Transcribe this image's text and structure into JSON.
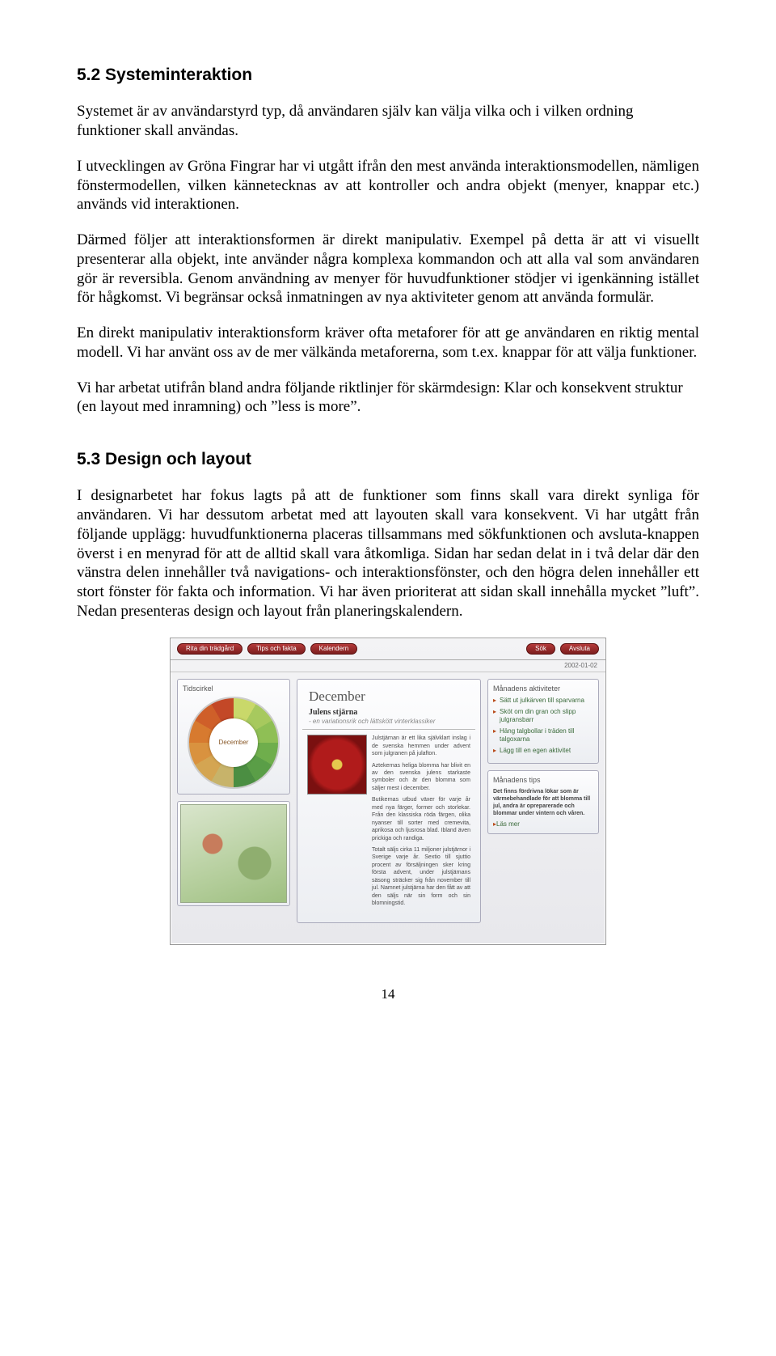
{
  "h1": "5.2 Systeminteraktion",
  "p1": "Systemet är av användarstyrd typ, då användaren själv kan välja vilka och i vilken ordning funktioner skall användas.",
  "p2": "I utvecklingen av Gröna Fingrar har vi utgått ifrån den mest använda interaktionsmodellen, nämligen fönstermodellen, vilken kännetecknas av att kontroller och andra objekt (menyer, knappar etc.) används vid interaktionen.",
  "p3": "Därmed följer att interaktionsformen är direkt manipulativ. Exempel på detta är att vi visuellt presenterar alla objekt, inte använder några komplexa kommandon och att alla val som användaren gör är reversibla. Genom användning av menyer för huvudfunktioner stödjer vi igenkänning istället för hågkomst. Vi begränsar också inmatningen av nya aktiviteter genom att använda formulär.",
  "p4": "En direkt manipulativ interaktionsform kräver ofta metaforer för att ge användaren en riktig mental modell. Vi har använt oss av de mer välkända metaforerna, som t.ex. knappar för att välja funktioner.",
  "p5": "Vi har arbetat utifrån bland andra följande riktlinjer för skärmdesign: Klar och konsekvent struktur (en layout med inramning) och ”less is more”.",
  "h2": "5.3 Design och layout",
  "p6": "I designarbetet har fokus lagts på att de funktioner som finns skall vara direkt synliga för användaren. Vi har dessutom arbetat med att layouten skall vara konsekvent. Vi har utgått från följande upplägg: huvudfunktionerna placeras tillsammans med sökfunktionen och avsluta-knappen överst i en menyrad för att de alltid skall vara åtkomliga. Sidan har sedan delat in i två delar där den vänstra delen innehåller två navigations- och interaktionsfönster, och den högra delen innehåller ett stort fönster för fakta och information. Vi har även prioriterat att sidan skall innehålla mycket ”luft”. Nedan presenteras design och layout från planeringskalendern.",
  "shot": {
    "menu": {
      "a": "Rita din trädgård",
      "b": "Tips och fakta",
      "c": "Kalendern",
      "d": "Sök",
      "e": "Avsluta"
    },
    "date": "2002-01-02",
    "left": {
      "panel1_title": "Tidscirkel",
      "wheel_label": "December"
    },
    "center": {
      "title": "December",
      "subtitle": "Julens stjärna",
      "subtitle2": "- en variationsrik och lättskött vinterklassiker",
      "para1": "Julstjärnan är ett lika självklart inslag i de svenska hemmen under advent som julgranen på julafton.",
      "para2": "Aztekernas heliga blomma har blivit en av den svenska julens starkaste symboler och är den blomma som säljer mest i december.",
      "para3": "Butikernas utbud växer för varje år med nya färger, former och storlekar. Från den klassiska röda färgen, olika nyanser till sorter med cremevita, aprikosa och ljusrosa blad. Ibland även prickiga och randiga.",
      "para4": "Totalt säljs cirka 11 miljoner julstjärnor i Sverige varje år. Sextio till sjuttio procent av försäljningen sker kring första advent, under julstjärnans säsong sträcker sig från november till jul. Namnet julstjärna har den fått av att den säljs när sin form och sin blomningstid."
    },
    "right": {
      "panel1_title": "Månadens aktiviteter",
      "links": {
        "a": "Sätt ut julkärven till sparvarna",
        "b": "Sköt om din gran och slipp julgransbarr",
        "c": "Häng talgbollar i träden till talgoxarna",
        "d": "Lägg till en egen aktivitet"
      },
      "panel2_title": "Månadens tips",
      "tip": "Det finns fördrivna lökar som är värmebehandlade för att blomma till jul, andra är opreparerade och blommar under vintern och våren.",
      "readmore": "Läs mer"
    }
  },
  "pagenum": "14"
}
